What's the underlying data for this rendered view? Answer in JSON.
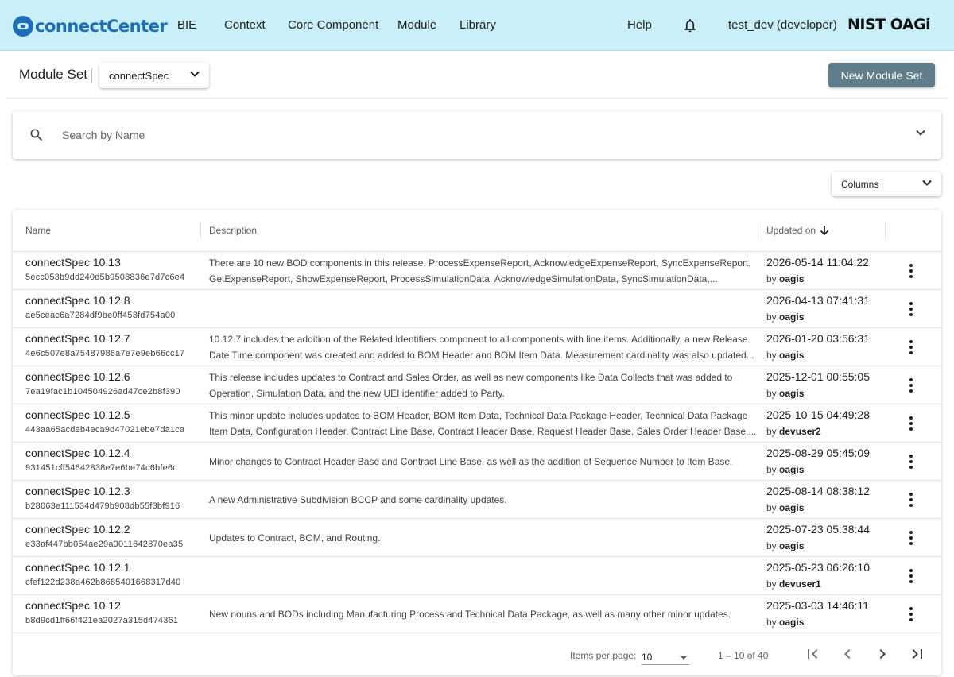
{
  "header": {
    "logo_text": "connectCenter",
    "nav": [
      "BIE",
      "Context",
      "Core Component",
      "Module",
      "Library"
    ],
    "help": "Help",
    "user": "test_dev (developer)",
    "org_logo": "NIST OAGi",
    "bell_icon": "bell-icon"
  },
  "module_set": {
    "label": "Module Set",
    "selected": "connectSpec",
    "new_button": "New Module Set"
  },
  "search": {
    "placeholder": "Search by Name",
    "value": ""
  },
  "columns_button": "Columns",
  "table": {
    "headers": {
      "name": "Name",
      "description": "Description",
      "updated_on": "Updated on"
    },
    "by_prefix": "by",
    "rows": [
      {
        "name": "connectSpec 10.13",
        "hash": "5ecc053b9dd240d5b9508836e7d7c6e4",
        "description": "There are 10 new BOD components in this release. ProcessExpenseReport, AcknowledgeExpenseReport, SyncExpenseReport, GetExpenseReport, ShowExpenseReport, ProcessSimulationData, AcknowledgeSimulationData, SyncSimulationData,...",
        "date": "2026-05-14 11:04:22",
        "user": "oagis"
      },
      {
        "name": "connectSpec 10.12.8",
        "hash": "ae5ceac6a7284df9be0ff453fd754a00",
        "description": "",
        "date": "2026-04-13 07:41:31",
        "user": "oagis"
      },
      {
        "name": "connectSpec 10.12.7",
        "hash": "4e6c507e8a75487986a7e7e9eb66cc17",
        "description": "10.12.7 includes the addition of the Related Identifiers component to all components with line items. Additionally, a new Release Date Time component was created and added to BOM Header and BOM Item Data. Measurement cardinality was also updated...",
        "date": "2026-01-20 03:56:31",
        "user": "oagis"
      },
      {
        "name": "connectSpec 10.12.6",
        "hash": "7ea19fac1b104504926ad47ce2b8f390",
        "description": "This release includes updates to Contract and Sales Order, as well as new components like Data Collects that was added to Operation, Simulation Data, and the new UEI identifier added to Party.",
        "date": "2025-12-01 00:55:05",
        "user": "oagis"
      },
      {
        "name": "connectSpec 10.12.5",
        "hash": "443aa65acdeb4eca9d47021ebe7da1ca",
        "description": "This minor update includes updates to BOM Header, BOM Item Data, Technical Data Package Header, Technical Data Package Item Data, Configuration Header, Contract Line Base, Contract Header Base, Request Header Base, Sales Order Header Base,...",
        "date": "2025-10-15 04:49:28",
        "user": "devuser2"
      },
      {
        "name": "connectSpec 10.12.4",
        "hash": "931451cff54642838e7e6be74c6bfe6c",
        "description": "Minor changes to Contract Header Base and Contract Line Base, as well as the addition of Sequence Number to Item Base.",
        "date": "2025-08-29 05:45:09",
        "user": "oagis"
      },
      {
        "name": "connectSpec 10.12.3",
        "hash": "b28063e111534d479b908db55f3bf916",
        "description": "A new Administrative Subdivision BCCP and some cardinality updates.",
        "date": "2025-08-14 08:38:12",
        "user": "oagis"
      },
      {
        "name": "connectSpec 10.12.2",
        "hash": "e33af447bb054ae29a0011642870ea35",
        "description": "Updates to Contract, BOM, and Routing.",
        "date": "2025-07-23 05:38:44",
        "user": "oagis"
      },
      {
        "name": "connectSpec 10.12.1",
        "hash": "cfef122d238a462b8685401668317d40",
        "description": "",
        "date": "2025-05-23 06:26:10",
        "user": "devuser1"
      },
      {
        "name": "connectSpec 10.12",
        "hash": "b8d9cd1ff66f421ea2027a315d474361",
        "description": "New nouns and BODs including Manufacturing Process and Technical Data Package, as well as many other minor updates.",
        "date": "2025-03-03 14:46:11",
        "user": "oagis"
      }
    ]
  },
  "paginator": {
    "items_per_page_label": "Items per page:",
    "items_per_page": "10",
    "range": "1 – 10 of 40"
  }
}
